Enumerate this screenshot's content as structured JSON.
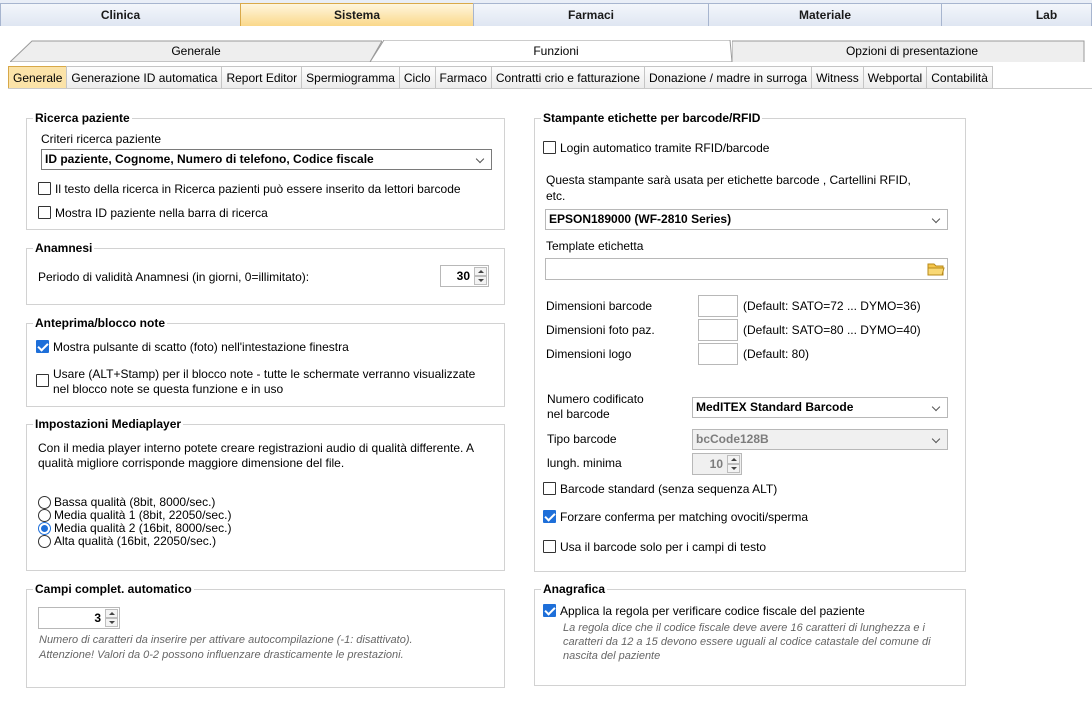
{
  "top_tabs": [
    "Clinica",
    "Sistema",
    "Farmaci",
    "Materiale",
    "Lab"
  ],
  "sub_tabs": [
    "Generale",
    "Funzioni",
    "Opzioni di presentazione"
  ],
  "tabs3": [
    "Generale",
    "Generazione ID automatica",
    "Report Editor",
    "Spermiogramma",
    "Ciclo",
    "Farmaco",
    "Contratti crio e fatturazione",
    "Donazione / madre in surroga",
    "Witness",
    "Webportal",
    "Contabilità"
  ],
  "ricerca": {
    "title": "Ricerca paziente",
    "criteri_label": "Criteri ricerca paziente",
    "criteri_value": "ID paziente, Cognome, Numero di telefono, Codice fiscale",
    "chk_barcode": "Il testo della ricerca in Ricerca pazienti può essere inserito da lettori barcode",
    "chk_id": "Mostra ID paziente nella barra di ricerca"
  },
  "anamnesi": {
    "title": "Anamnesi",
    "periodo_label": "Periodo di validità Anamnesi (in giorni, 0=illimitato):",
    "periodo_value": "30"
  },
  "anteprima": {
    "title": "Anteprima/blocco note",
    "chk_scatto": "Mostra pulsante di scatto (foto) nell'intestazione finestra",
    "chk_stamp_line1": "Usare (ALT+Stamp) per il blocco note - tutte le schermate verranno   visualizzate",
    "chk_stamp_line2": "nel blocco note se questa funzione e in uso"
  },
  "media": {
    "title": "Impostazioni Mediaplayer",
    "desc_line1": "Con il media player interno potete creare registrazioni audio di qualità differente. A",
    "desc_line2": "qualità migliore corrisponde maggiore dimensione del file.",
    "options": [
      "Bassa qualità (8bit, 8000/sec.)",
      "Media qualità 1 (8bit, 22050/sec.)",
      "Media qualità 2 (16bit, 8000/sec.)",
      "Alta qualità (16bit, 22050/sec.)"
    ],
    "selected": "Media qualità 2 (16bit, 8000/sec.)"
  },
  "campi": {
    "title": "Campi complet. automatico",
    "value": "3",
    "note_line1": "Numero di caratteri da inserire per attivare autocompilazione (-1: disattivato).",
    "note_line2": "Attenzione! Valori da 0-2 possono influenzare drasticamente le prestazioni."
  },
  "stampante": {
    "title": "Stampante etichette per barcode/RFID",
    "chk_login": "Login automatico tramite RFID/barcode",
    "desc_line1": "Questa stampante sarà usata per etichette barcode , Cartellini RFID,",
    "desc_line2": "etc.",
    "printer": "EPSON189000 (WF-2810 Series)",
    "template_label": "Template etichetta",
    "dim_barcode_label": "Dimensioni barcode",
    "dim_barcode_default": "(Default: SATO=72 ... DYMO=36)",
    "dim_foto_label": "Dimensioni foto paz.",
    "dim_foto_default": "(Default: SATO=80 ... DYMO=40)",
    "dim_logo_label": "Dimensioni logo",
    "dim_logo_default": "(Default: 80)",
    "numero_label_line1": "Numero codificato",
    "numero_label_line2": "nel barcode",
    "numero_value": "MedITEX Standard Barcode",
    "tipo_label": "Tipo barcode",
    "tipo_value": "bcCode128B",
    "lungh_label": "lungh. minima",
    "lungh_value": "10",
    "chk_standard": "Barcode standard (senza sequenza ALT)",
    "chk_forzare": "Forzare conferma per matching ovociti/sperma",
    "chk_usa": "Usa il barcode solo per i campi di testo"
  },
  "anagrafica": {
    "title": "Anagrafica",
    "chk_regola": "Applica la regola per verificare codice fiscale del paziente",
    "note_line1": "La regola dice che il codice fiscale deve avere 16 caratteri di lunghezza e i",
    "note_line2": "caratteri da 12 a 15 devono essere uguali al codice catastale del comune di",
    "note_line3": "nascita del paziente"
  }
}
